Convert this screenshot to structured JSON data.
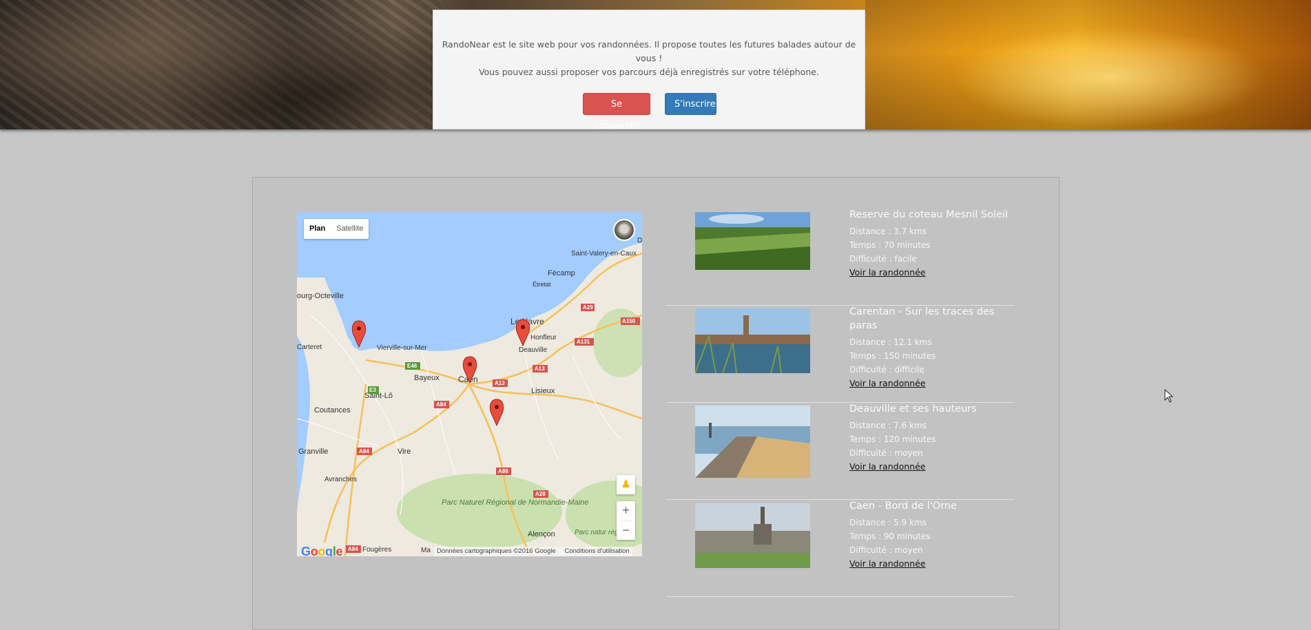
{
  "intro": {
    "line1": "RandoNear est le site web pour vos randonnées. Il propose toutes les futures balades autour de vous !",
    "line2": "Vous pouvez aussi proposer vos parcours déjà enregistrés sur votre téléphone.",
    "login_label": "Se connecter",
    "signup_label": "S'inscrire",
    "login_color": "#d9534f",
    "signup_color": "#337ab7"
  },
  "map": {
    "type_buttons": [
      "Plan",
      "Satellite"
    ],
    "active_type": "Plan",
    "logo": "Google",
    "footer_data": "Données cartographiques ©2016 Google",
    "footer_terms": "Conditions d'utilisation",
    "zoom_in": "+",
    "zoom_out": "−",
    "places": [
      "Saint-Valery-en-Caux",
      "Fécamp",
      "Étretat",
      "ourg-Octeville",
      "Le Havre",
      "Honfleur",
      "Deauville",
      "Carteret",
      "Vierville-sur-Mer",
      "Bayeux",
      "Caen",
      "Lisieux",
      "Saint-Lô",
      "Coutances",
      "Granville",
      "Vire",
      "Avranches",
      "Parc Naturel Régional de Normandie-Maine",
      "Parc natur régional",
      "Alençon",
      "Fougères",
      "Ma",
      "D"
    ],
    "roads": [
      "A29",
      "A150",
      "A131",
      "A13",
      "A13",
      "E46",
      "E3",
      "A84",
      "A84",
      "A88",
      "A28",
      "A84"
    ],
    "marker_count": 4
  },
  "hikes": [
    {
      "title": "Reserve du coteau Mesnil Soleil",
      "distance": "Distance : 3.7 kms",
      "time": "Temps : 70 minutes",
      "difficulty": "Difficulté : facile",
      "link": "Voir la randonnée"
    },
    {
      "title": "Carentan - Sur les traces des paras",
      "distance": "Distance : 12.1 kms",
      "time": "Temps : 150 minutes",
      "difficulty": "Difficulté : difficile",
      "link": "Voir la randonnée"
    },
    {
      "title": "Deauville et ses hauteurs",
      "distance": "Distance : 7.6 kms",
      "time": "Temps : 120 minutes",
      "difficulty": "Difficulté : moyen",
      "link": "Voir la randonnée"
    },
    {
      "title": "Caen - Bord de l'Orne",
      "distance": "Distance : 5.9 kms",
      "time": "Temps : 90 minutes",
      "difficulty": "Difficulté : moyen",
      "link": "Voir la randonnée"
    }
  ]
}
